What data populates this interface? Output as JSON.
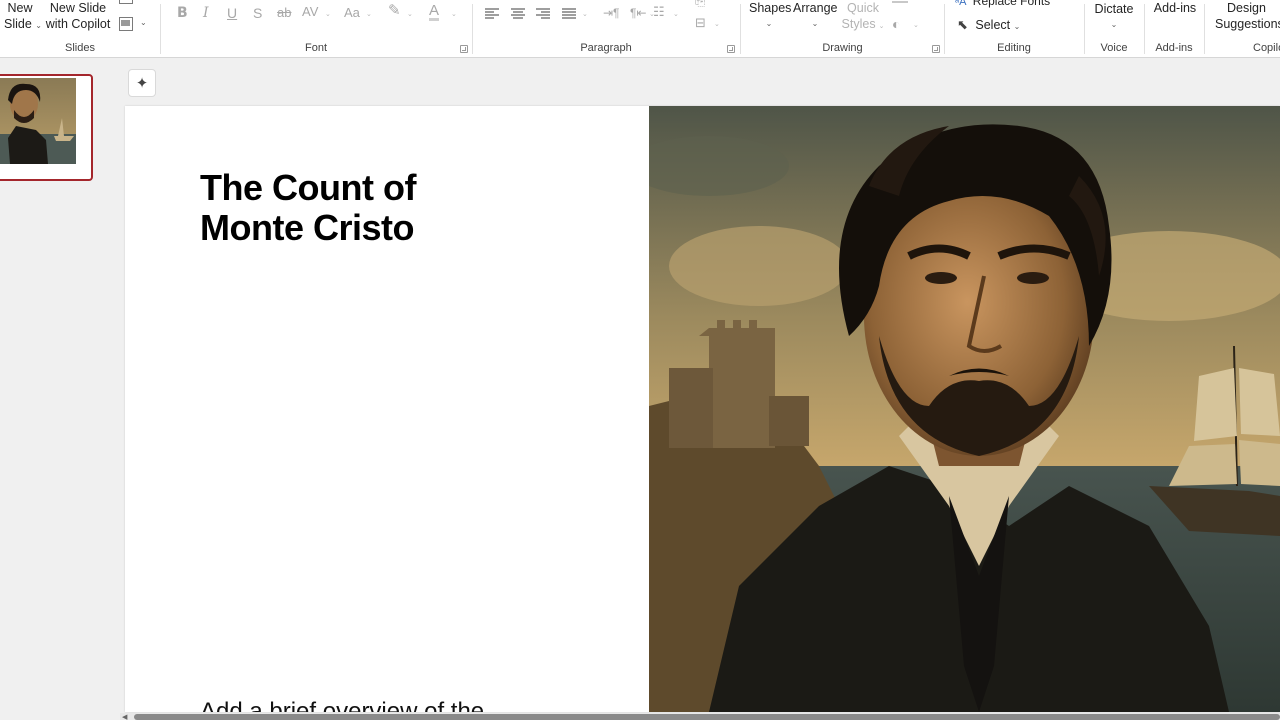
{
  "ribbon": {
    "slides": {
      "new_slide_line1": "New",
      "new_slide_line2": "Slide",
      "copilot_line1": "New Slide",
      "copilot_line2": "with Copilot",
      "group_label": "Slides"
    },
    "font": {
      "group_label": "Font",
      "bold": "B",
      "italic": "I",
      "underline": "U",
      "strike": "S",
      "strike2": "ab",
      "spacing": "AV",
      "case": "Aa",
      "font_color": "A"
    },
    "paragraph": {
      "group_label": "Paragraph"
    },
    "drawing": {
      "shapes": "Shapes",
      "arrange": "Arrange",
      "quick": "Quick",
      "styles": "Styles",
      "group_label": "Drawing"
    },
    "editing": {
      "replace_fonts": "Replace Fonts",
      "select": "Select",
      "group_label": "Editing"
    },
    "voice": {
      "dictate": "Dictate",
      "group_label": "Voice"
    },
    "addins": {
      "addins": "Add-ins",
      "group_label": "Add-ins"
    },
    "design": {
      "line1": "Design",
      "line2": "Suggestions"
    },
    "copilot": {
      "group_label": "Copilo"
    }
  },
  "slide": {
    "title_line1": "The Count of",
    "title_line2": "Monte Cristo",
    "body_partial": "Add a brief overview of the"
  },
  "icons": {
    "designer": "sparkle-icon",
    "replace_fonts": "replace-fonts-icon",
    "select": "cursor-select-icon"
  },
  "colors": {
    "selected_thumb_border": "#a4262c",
    "ribbon_bg": "#ffffff",
    "workspace_bg": "#f0f0f0"
  }
}
